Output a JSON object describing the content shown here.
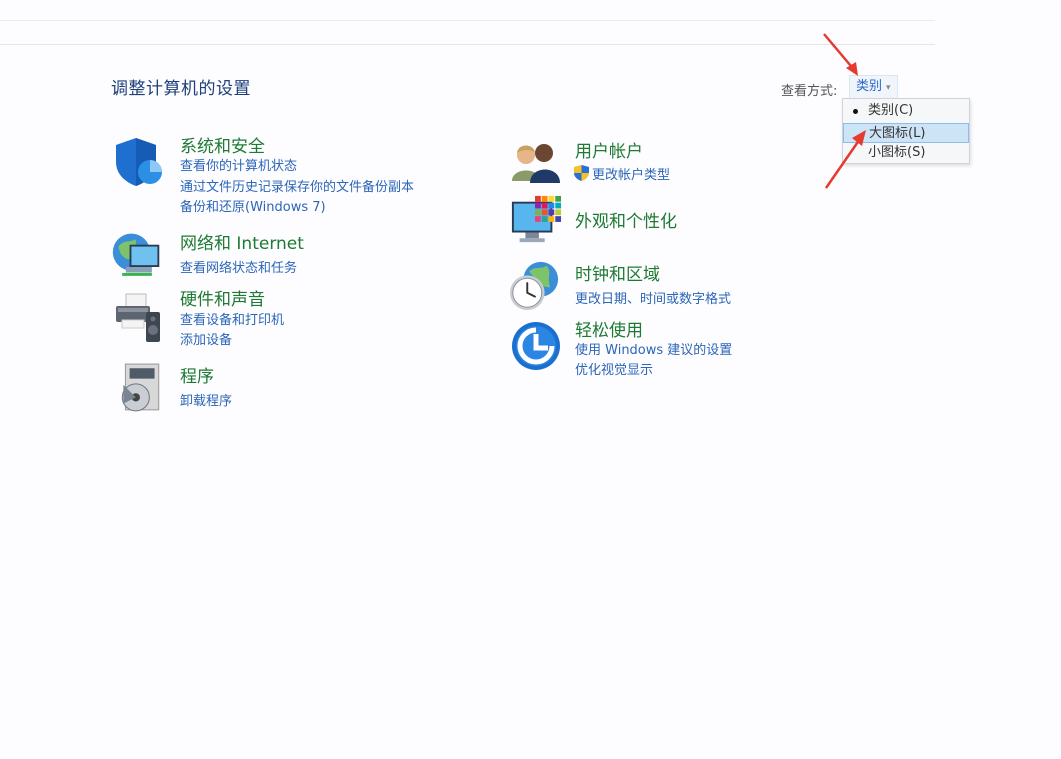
{
  "header": {
    "page_title": "调整计算机的设置",
    "view_by_label": "查看方式:",
    "view_by_value": "类别"
  },
  "view_menu": {
    "items": [
      {
        "label": "类别(C)",
        "selected": true
      },
      {
        "label": "大图标(L)",
        "highlighted": true
      },
      {
        "label": "小图标(S)"
      }
    ]
  },
  "left_column": [
    {
      "title": "系统和安全",
      "icon": "shield-icon",
      "links": [
        "查看你的计算机状态",
        "通过文件历史记录保存你的文件备份副本",
        "备份和还原(Windows 7)"
      ]
    },
    {
      "title": "网络和 Internet",
      "icon": "network-globe-icon",
      "links": [
        "查看网络状态和任务"
      ]
    },
    {
      "title": "硬件和声音",
      "icon": "printer-icon",
      "links": [
        "查看设备和打印机",
        "添加设备"
      ]
    },
    {
      "title": "程序",
      "icon": "programs-disc-icon",
      "links": [
        "卸载程序"
      ]
    }
  ],
  "right_column": [
    {
      "title": "用户帐户",
      "icon": "users-icon",
      "links": [
        "更改帐户类型"
      ]
    },
    {
      "title": "外观和个性化",
      "icon": "monitor-palette-icon",
      "links": []
    },
    {
      "title": "时钟和区域",
      "icon": "clock-globe-icon",
      "links": [
        "更改日期、时间或数字格式"
      ]
    },
    {
      "title": "轻松使用",
      "icon": "ease-of-access-icon",
      "links": [
        "使用 Windows 建议的设置",
        "优化视觉显示"
      ]
    }
  ],
  "colors": {
    "title_green": "#1d7a33",
    "link_blue": "#2b66b8",
    "annotation_red": "#e53a2f"
  }
}
